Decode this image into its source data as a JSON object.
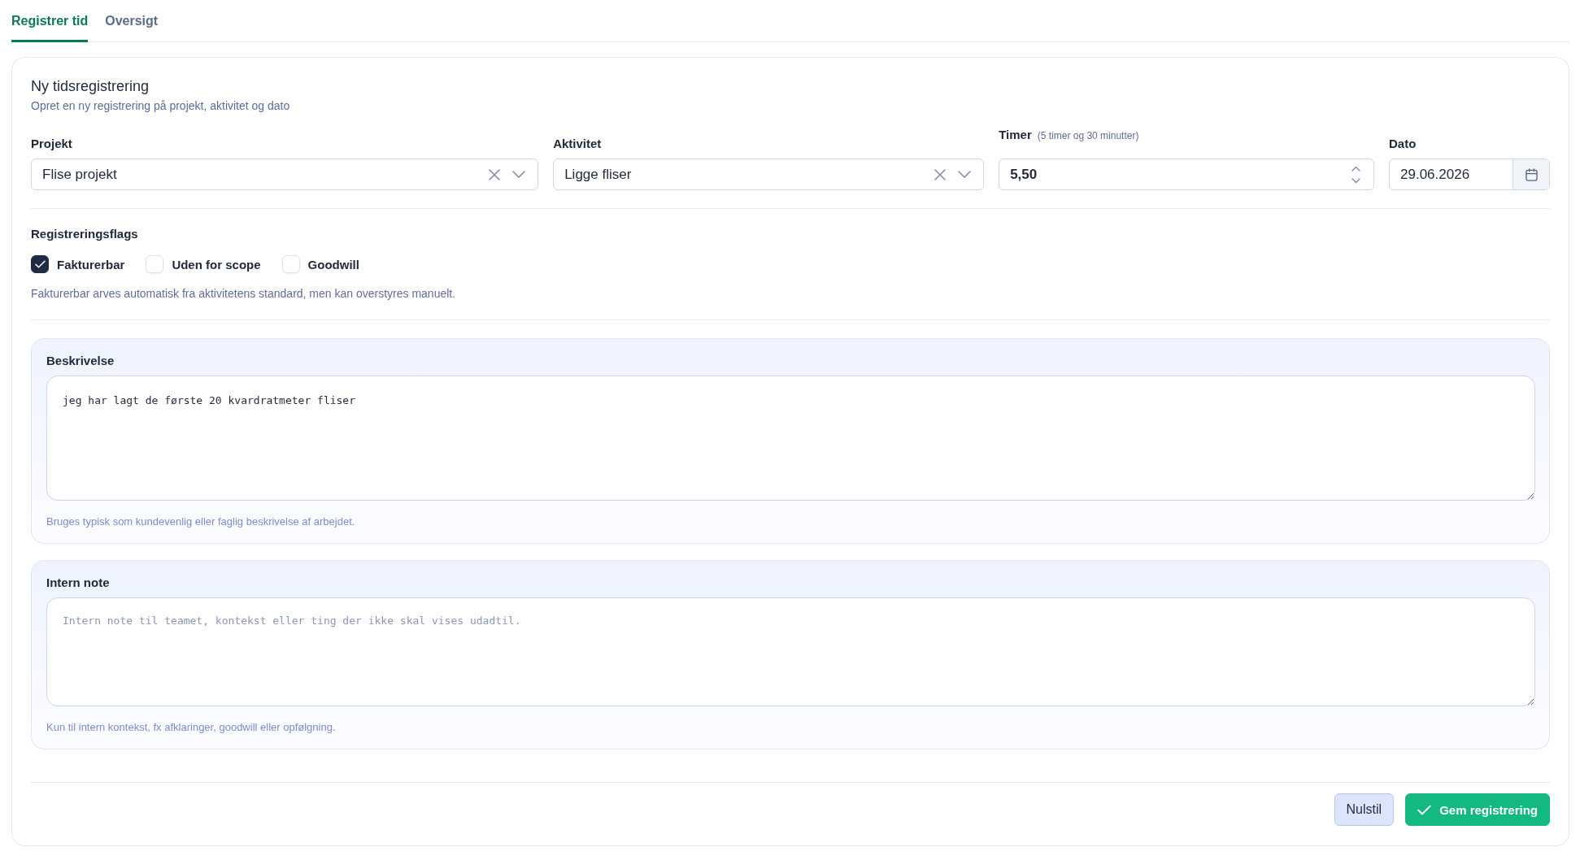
{
  "tabs": [
    {
      "label": "Registrer tid",
      "selected": true
    },
    {
      "label": "Oversigt",
      "selected": false
    }
  ],
  "form": {
    "title": "Ny tidsregistrering",
    "subtitle": "Opret en ny registrering på projekt, aktivitet og dato",
    "fields": [
      {
        "kind": "select",
        "label": "Projekt",
        "value": "Flise projekt"
      },
      {
        "kind": "select",
        "label": "Aktivitet",
        "value": "Ligge fliser"
      },
      {
        "kind": "number",
        "label": "Timer",
        "hint": "(5 timer og 30 minutter)",
        "value": "5,50"
      },
      {
        "kind": "date",
        "label": "Dato",
        "value": "29.06.2026"
      }
    ],
    "flags": {
      "title": "Registreringsflags",
      "options": [
        {
          "label": "Fakturerbar",
          "checked": true
        },
        {
          "label": "Uden for scope",
          "checked": false
        },
        {
          "label": "Goodwill",
          "checked": false
        }
      ],
      "help": "Fakturerbar arves automatisk fra aktivitetens standard, men kan overstyres manuelt."
    },
    "sections": [
      {
        "label": "Beskrivelse",
        "value": "jeg har lagt de første 20 kvardratmeter fliser",
        "help": "Bruges typisk som kundevenlig eller faglig beskrivelse af arbejdet."
      },
      {
        "label": "Intern note",
        "placeholder": "Intern note til teamet, kontekst eller ting der ikke skal vises udadtil.",
        "help": "Kun til intern kontekst, fx afklaringer, goodwill eller opfølgning."
      }
    ],
    "buttons": [
      {
        "kind": "secondary",
        "label": "Nulstil"
      },
      {
        "kind": "primary",
        "label": "Gem registrering"
      }
    ]
  }
}
